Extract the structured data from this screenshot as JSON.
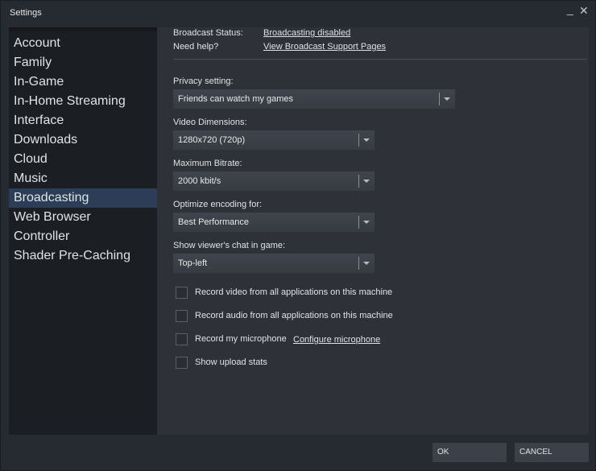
{
  "window": {
    "title": "Settings",
    "minimize": "_",
    "close": "✕"
  },
  "sidebar": {
    "items": [
      {
        "label": "Account"
      },
      {
        "label": "Family"
      },
      {
        "label": "In-Game"
      },
      {
        "label": "In-Home Streaming"
      },
      {
        "label": "Interface"
      },
      {
        "label": "Downloads"
      },
      {
        "label": "Cloud"
      },
      {
        "label": "Music"
      },
      {
        "label": "Broadcasting",
        "selected": true
      },
      {
        "label": "Web Browser"
      },
      {
        "label": "Controller"
      },
      {
        "label": "Shader Pre-Caching"
      }
    ]
  },
  "main": {
    "status_label": "Broadcast Status:",
    "status_link": "Broadcasting disabled",
    "help_label": "Need help?",
    "help_link": "View Broadcast Support Pages",
    "privacy": {
      "label": "Privacy setting:",
      "value": "Friends can watch my games"
    },
    "dimensions": {
      "label": "Video Dimensions:",
      "value": "1280x720 (720p)"
    },
    "bitrate": {
      "label": "Maximum Bitrate:",
      "value": "2000 kbit/s"
    },
    "encoding": {
      "label": "Optimize encoding for:",
      "value": "Best Performance"
    },
    "chat": {
      "label": "Show viewer's chat in game:",
      "value": "Top-left"
    },
    "checkboxes": [
      {
        "label": "Record video from all applications on this machine",
        "checked": false
      },
      {
        "label": "Record audio from all applications on this machine",
        "checked": false
      },
      {
        "label": "Record my microphone",
        "checked": false
      },
      {
        "label": "Show upload stats",
        "checked": false
      }
    ],
    "configure_mic": "Configure microphone"
  },
  "footer": {
    "ok": "OK",
    "cancel": "CANCEL"
  }
}
